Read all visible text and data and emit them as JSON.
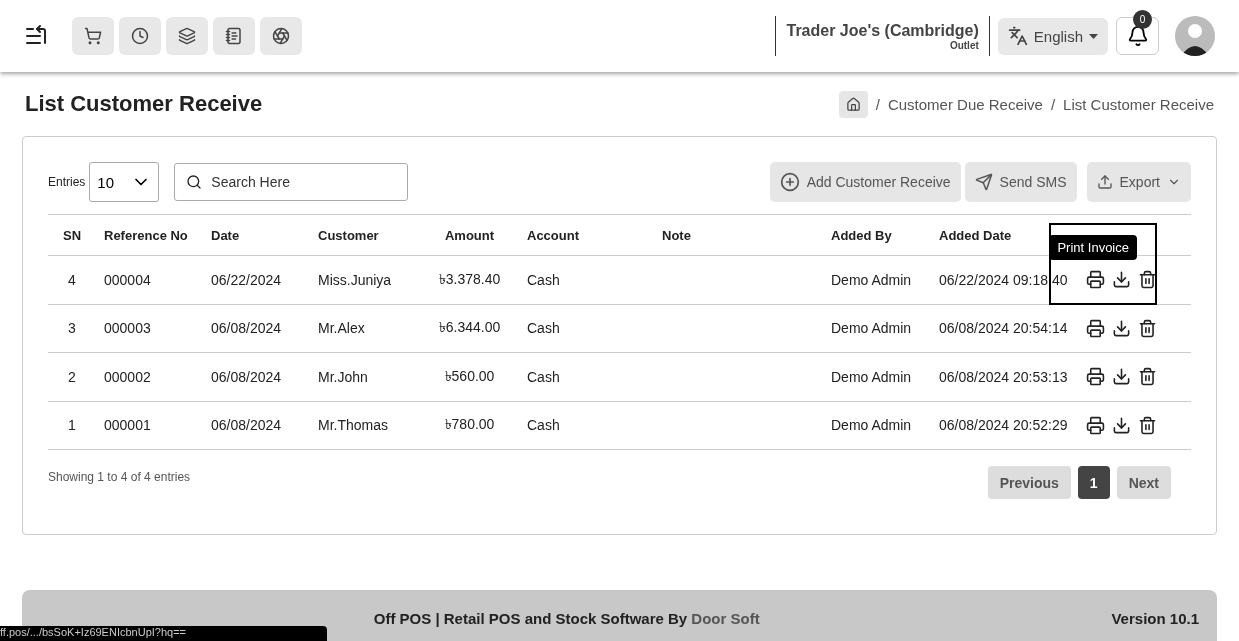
{
  "header": {
    "outlet_name": "Trader Joe's (Cambridge)",
    "outlet_label": "Outlet",
    "language": "English",
    "notification_count": "0"
  },
  "page": {
    "title": "List Customer Receive",
    "breadcrumb": [
      "Customer Due Receive",
      "List Customer Receive"
    ],
    "separators": [
      "/",
      "/"
    ]
  },
  "toolbar": {
    "entries_label": "Entries",
    "entries_value": "10",
    "search_placeholder": "Search Here",
    "buttons": [
      {
        "kind": "add",
        "label": "Add Customer Receive"
      },
      {
        "kind": "sms",
        "label": "Send SMS"
      },
      {
        "kind": "export",
        "label": "Export"
      }
    ]
  },
  "table": {
    "columns": [
      "SN",
      "Reference No",
      "Date",
      "Customer",
      "Amount",
      "Account",
      "Note",
      "Added By",
      "Added Date",
      ""
    ],
    "rows": [
      {
        "cells": [
          "4",
          "000004",
          "06/22/2024",
          "Miss.Juniya",
          "৳3.378.40",
          "Cash",
          "",
          "Demo Admin",
          "06/22/2024 09:18:40"
        ],
        "focused": true
      },
      {
        "cells": [
          "3",
          "000003",
          "06/08/2024",
          "Mr.Alex",
          "৳6.344.00",
          "Cash",
          "",
          "Demo Admin",
          "06/08/2024 20:54:14"
        ],
        "focused": false
      },
      {
        "cells": [
          "2",
          "000002",
          "06/08/2024",
          "Mr.John",
          "৳560.00",
          "Cash",
          "",
          "Demo Admin",
          "06/08/2024 20:53:13"
        ],
        "focused": false
      },
      {
        "cells": [
          "1",
          "000001",
          "06/08/2024",
          "Mr.Thomas",
          "৳780.00",
          "Cash",
          "",
          "Demo Admin",
          "06/08/2024 20:52:29"
        ],
        "focused": false
      }
    ],
    "tooltip": "Print Invoice"
  },
  "pagination": {
    "summary": "Showing 1 to 4 of 4 entries",
    "previous": "Previous",
    "pages": [
      {
        "label": "1",
        "selected": true
      }
    ],
    "next": "Next"
  },
  "footer": {
    "text": "Off POS | Retail POS and Stock Software By",
    "brand": "Door Soft",
    "version": "Version 10.1"
  },
  "status_url": "ff.pos/.../bsSoK+Iz69ENIcbnUpI?hq=="
}
